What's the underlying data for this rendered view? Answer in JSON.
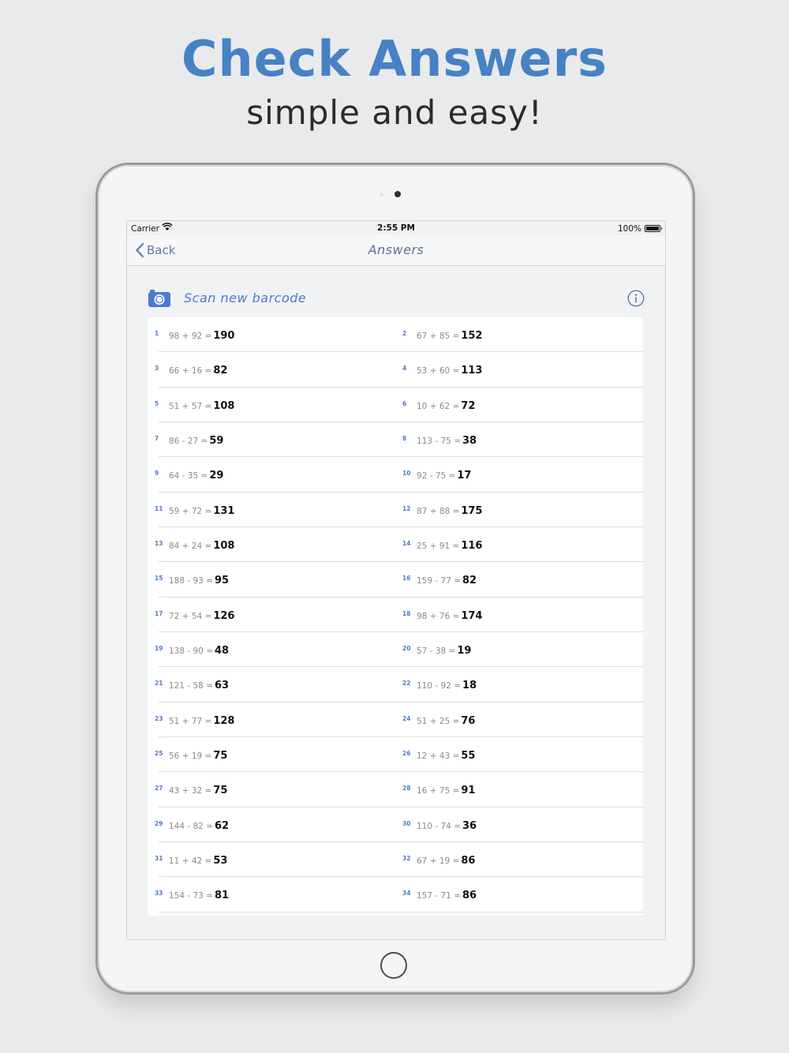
{
  "promo": {
    "headline": "Check Answers",
    "subline": "simple and easy!"
  },
  "statusbar": {
    "carrier": "Carrier",
    "time": "2:55 PM",
    "battery": "100%"
  },
  "navbar": {
    "back_label": "Back",
    "title": "Answers"
  },
  "scan": {
    "label": "Scan new barcode"
  },
  "colors": {
    "accent": "#4a7ccb",
    "headline": "#4682c4"
  },
  "answers": [
    {
      "n": "1",
      "expr": "98 + 92 =",
      "ans": "190"
    },
    {
      "n": "2",
      "expr": "67 + 85 =",
      "ans": "152"
    },
    {
      "n": "3",
      "expr": "66 + 16 =",
      "ans": "82"
    },
    {
      "n": "4",
      "expr": "53 + 60 =",
      "ans": "113"
    },
    {
      "n": "5",
      "expr": "51 + 57 =",
      "ans": "108"
    },
    {
      "n": "6",
      "expr": "10 + 62 =",
      "ans": "72"
    },
    {
      "n": "7",
      "expr": "86 - 27 =",
      "ans": "59"
    },
    {
      "n": "8",
      "expr": "113 - 75 =",
      "ans": "38"
    },
    {
      "n": "9",
      "expr": "64 - 35 =",
      "ans": "29"
    },
    {
      "n": "10",
      "expr": "92 - 75 =",
      "ans": "17"
    },
    {
      "n": "11",
      "expr": "59 + 72 =",
      "ans": "131"
    },
    {
      "n": "12",
      "expr": "87 + 88 =",
      "ans": "175"
    },
    {
      "n": "13",
      "expr": "84 + 24 =",
      "ans": "108"
    },
    {
      "n": "14",
      "expr": "25 + 91 =",
      "ans": "116"
    },
    {
      "n": "15",
      "expr": "188 - 93 =",
      "ans": "95"
    },
    {
      "n": "16",
      "expr": "159 - 77 =",
      "ans": "82"
    },
    {
      "n": "17",
      "expr": "72 + 54 =",
      "ans": "126"
    },
    {
      "n": "18",
      "expr": "98 + 76 =",
      "ans": "174"
    },
    {
      "n": "19",
      "expr": "138 - 90 =",
      "ans": "48"
    },
    {
      "n": "20",
      "expr": "57 - 38 =",
      "ans": "19"
    },
    {
      "n": "21",
      "expr": "121 - 58 =",
      "ans": "63"
    },
    {
      "n": "22",
      "expr": "110 - 92 =",
      "ans": "18"
    },
    {
      "n": "23",
      "expr": "51 + 77 =",
      "ans": "128"
    },
    {
      "n": "24",
      "expr": "51 + 25 =",
      "ans": "76"
    },
    {
      "n": "25",
      "expr": "56 + 19 =",
      "ans": "75"
    },
    {
      "n": "26",
      "expr": "12 + 43 =",
      "ans": "55"
    },
    {
      "n": "27",
      "expr": "43 + 32 =",
      "ans": "75"
    },
    {
      "n": "28",
      "expr": "16 + 75 =",
      "ans": "91"
    },
    {
      "n": "29",
      "expr": "144 - 82 =",
      "ans": "62"
    },
    {
      "n": "30",
      "expr": "110 - 74 =",
      "ans": "36"
    },
    {
      "n": "31",
      "expr": "11 + 42 =",
      "ans": "53"
    },
    {
      "n": "32",
      "expr": "67 + 19 =",
      "ans": "86"
    },
    {
      "n": "33",
      "expr": "154 - 73 =",
      "ans": "81"
    },
    {
      "n": "34",
      "expr": "157 - 71 =",
      "ans": "86"
    }
  ]
}
